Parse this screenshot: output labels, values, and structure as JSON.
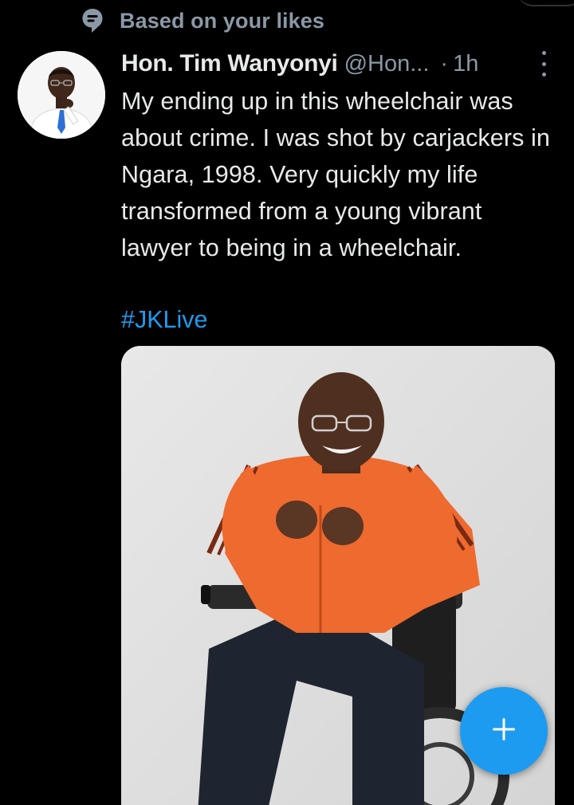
{
  "context": {
    "icon": "speech-bubble-icon",
    "label": "Based on your likes"
  },
  "tweet": {
    "author_name": "Hon. Tim Wanyonyi",
    "handle": "@Hon...",
    "separator": "·",
    "time": "1h",
    "avatar_icon": "profile-photo",
    "more_icon": "more-vertical-icon",
    "text": "My ending up in this wheelchair was about crime. I was shot by carjackers in Ngara, 1998. Very quickly my life transformed from a young vibrant lawyer to being in a wheelchair.",
    "hashtag": "#JKLive",
    "media_icon": "photo"
  },
  "fab": {
    "icon": "plus-icon"
  },
  "colors": {
    "background": "#000000",
    "primary_text": "#e7e9ea",
    "secondary_text": "#8b98a5",
    "accent": "#1d9bf0"
  }
}
